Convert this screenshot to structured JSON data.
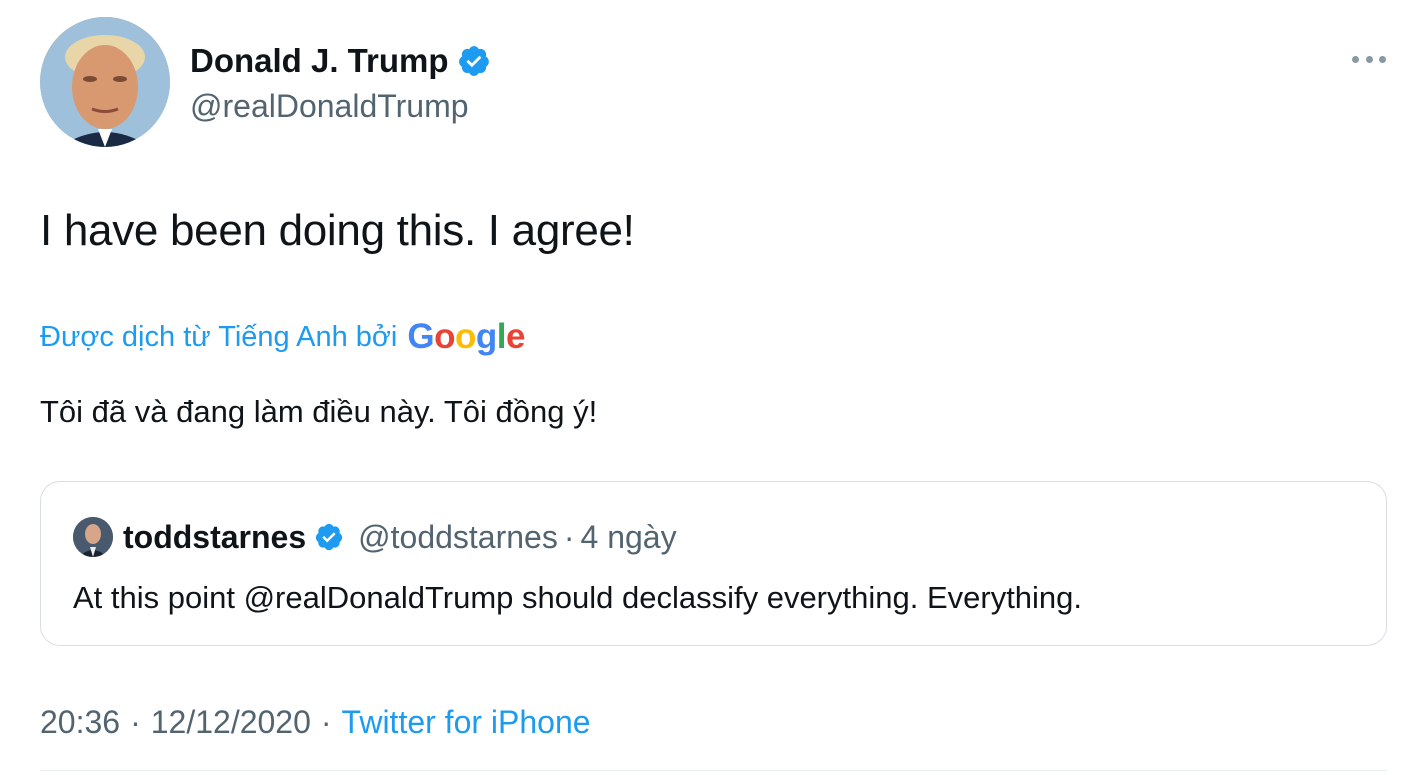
{
  "author": {
    "display_name": "Donald J. Trump",
    "handle": "@realDonaldTrump",
    "verified": true
  },
  "tweet": {
    "text": "I have been doing this. I agree!",
    "translation_label": "Được dịch từ Tiếng Anh bởi",
    "translation_provider": "Google",
    "translated_text": "Tôi đã và đang làm điều này. Tôi đồng ý!"
  },
  "quoted": {
    "display_name": "toddstarnes",
    "handle": "@toddstarnes",
    "dot": "·",
    "time": "4 ngày",
    "verified": true,
    "text": "At this point @realDonaldTrump should declassify everything. Everything."
  },
  "footer": {
    "time": "20:36",
    "sep1": "·",
    "date": "12/12/2020",
    "sep2": "·",
    "source": "Twitter for iPhone"
  },
  "icons": {
    "verified": "verified-badge-icon",
    "more": "more-options-icon"
  },
  "colors": {
    "accent": "#1d9bf0",
    "text": "#0f1419",
    "muted": "#536471",
    "border": "#d9dee3",
    "google_blue": "#4285f4",
    "google_red": "#ea4335",
    "google_yellow": "#fbbc05",
    "google_green": "#34a853"
  }
}
